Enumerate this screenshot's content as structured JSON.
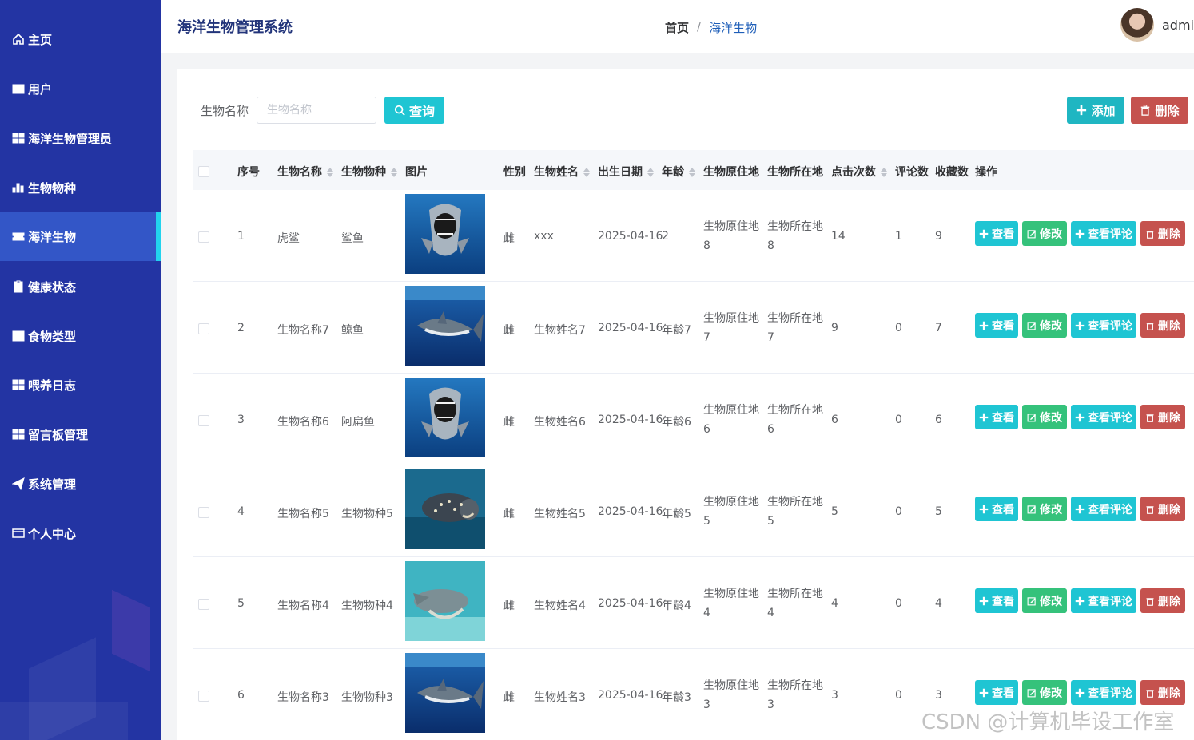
{
  "sidebar": {
    "items": [
      {
        "label": "主页",
        "icon": "home-icon"
      },
      {
        "label": "用户",
        "icon": "book-icon"
      },
      {
        "label": "海洋生物管理员",
        "icon": "grid-icon"
      },
      {
        "label": "生物物种",
        "icon": "bar-chart-icon"
      },
      {
        "label": "海洋生物",
        "icon": "ticket-icon",
        "active": true
      },
      {
        "label": "健康状态",
        "icon": "clipboard-icon"
      },
      {
        "label": "食物类型",
        "icon": "table-icon"
      },
      {
        "label": "喂养日志",
        "icon": "grid-icon"
      },
      {
        "label": "留言板管理",
        "icon": "grid-icon"
      },
      {
        "label": "系统管理",
        "icon": "send-icon"
      },
      {
        "label": "个人中心",
        "icon": "id-card-icon"
      }
    ]
  },
  "header": {
    "title": "海洋生物管理系统",
    "breadcrumb_home": "首页",
    "breadcrumb_sep": "/",
    "breadcrumb_current": "海洋生物",
    "username": "admin"
  },
  "search": {
    "label": "生物名称",
    "placeholder": "生物名称",
    "query_label": "查询"
  },
  "toolbar": {
    "add_label": "添加",
    "delete_label": "删除"
  },
  "table": {
    "columns": [
      "序号",
      "生物名称",
      "生物物种",
      "图片",
      "性别",
      "生物姓名",
      "出生日期",
      "年龄",
      "生物原住地",
      "生物所在地",
      "点击次数",
      "评论数",
      "收藏数",
      "操作"
    ],
    "rows": [
      {
        "index": "1",
        "name": "虎鲨",
        "species": "鲨鱼",
        "gender": "雌",
        "nickname": "xxx",
        "birth": "2025-04-16",
        "age": "2",
        "origin": "生物原住地8",
        "location": "生物所在地8",
        "clicks": "14",
        "comments": "1",
        "favorites": "9",
        "image": "shark-photo"
      },
      {
        "index": "2",
        "name": "生物名称7",
        "species": "鲸鱼",
        "gender": "雌",
        "nickname": "生物姓名7",
        "birth": "2025-04-16",
        "age": "年龄7",
        "origin": "生物原住地7",
        "location": "生物所在地7",
        "clicks": "9",
        "comments": "0",
        "favorites": "7",
        "image": "thresher-shark-photo"
      },
      {
        "index": "3",
        "name": "生物名称6",
        "species": "阿扁鱼",
        "gender": "雌",
        "nickname": "生物姓名6",
        "birth": "2025-04-16",
        "age": "年龄6",
        "origin": "生物原住地6",
        "location": "生物所在地6",
        "clicks": "6",
        "comments": "0",
        "favorites": "6",
        "image": "shark-photo"
      },
      {
        "index": "4",
        "name": "生物名称5",
        "species": "生物物种5",
        "gender": "雌",
        "nickname": "生物姓名5",
        "birth": "2025-04-16",
        "age": "年龄5",
        "origin": "生物原住地5",
        "location": "生物所在地5",
        "clicks": "5",
        "comments": "0",
        "favorites": "5",
        "image": "whale-shark-photo"
      },
      {
        "index": "5",
        "name": "生物名称4",
        "species": "生物物种4",
        "gender": "雌",
        "nickname": "生物姓名4",
        "birth": "2025-04-16",
        "age": "年龄4",
        "origin": "生物原住地4",
        "location": "生物所在地4",
        "clicks": "4",
        "comments": "0",
        "favorites": "4",
        "image": "turquoise-shark-photo"
      },
      {
        "index": "6",
        "name": "生物名称3",
        "species": "生物物种3",
        "gender": "雌",
        "nickname": "生物姓名3",
        "birth": "2025-04-16",
        "age": "年龄3",
        "origin": "生物原住地3",
        "location": "生物所在地3",
        "clicks": "3",
        "comments": "0",
        "favorites": "3",
        "image": "thresher-shark-photo"
      }
    ],
    "actions": {
      "view": "查看",
      "edit": "修改",
      "comments": "查看评论",
      "delete": "删除"
    }
  },
  "watermark": "CSDN @计算机毕设工作室",
  "colors": {
    "sidebar": "#2334a3",
    "sidebar_active": "#3356c7",
    "accent": "#22d3ee",
    "teal_button": "#1fc5d3",
    "green_button": "#35c27b",
    "red_button": "#c5524e",
    "title": "#22347a"
  }
}
